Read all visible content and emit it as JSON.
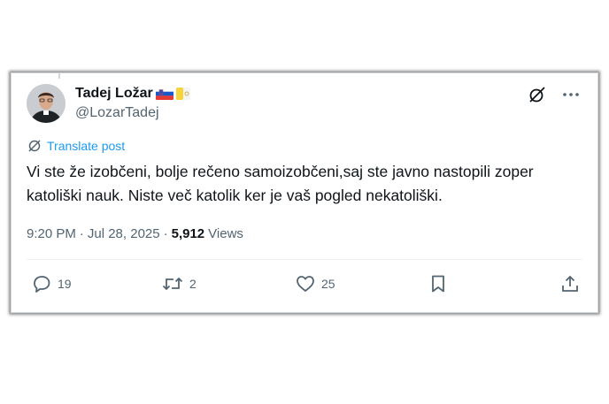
{
  "author": {
    "display_name": "Tadej Ložar",
    "handle": "@LozarTadej",
    "flags": [
      "slovenia-flag",
      "vatican-flag"
    ]
  },
  "translate_label": "Translate post",
  "post_text": "Vi ste že izobčeni, bolje rečeno samoizobčeni,saj ste javno nastopili zoper katoliški nauk. Niste več katolik ker je vaš pogled nekatoliški.",
  "meta": {
    "time": "9:20 PM",
    "date": "Jul 28, 2025",
    "separator": "·",
    "views_count": "5,912",
    "views_label": "Views"
  },
  "actions": {
    "replies": "19",
    "reposts": "2",
    "likes": "25"
  },
  "colors": {
    "accent": "#1d9bf0",
    "muted": "#536471",
    "text": "#0f1419"
  }
}
